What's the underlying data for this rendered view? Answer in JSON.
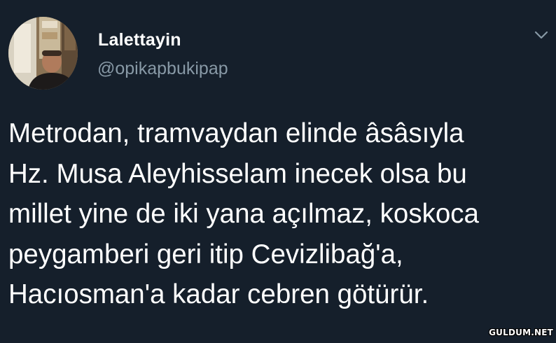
{
  "tweet": {
    "display_name": "Lalettayin",
    "handle": "@opikapbukipap",
    "text_lines": [
      "Metrodan, tramvaydan elinde âsâsıyla",
      "Hz. Musa Aleyhisselam inecek olsa bu",
      "millet yine de iki yana açılmaz, koskoca",
      "peygamberi geri itip Cevizlibağ'a,",
      "Hacıosman'a kadar cebren götürür."
    ],
    "caret_icon": "chevron-down-icon",
    "avatar_icon": "avatar"
  },
  "watermark": "GULDUM.NET",
  "colors": {
    "background": "#151f2b",
    "text": "#ffffff",
    "secondary_text": "#8899a6"
  }
}
